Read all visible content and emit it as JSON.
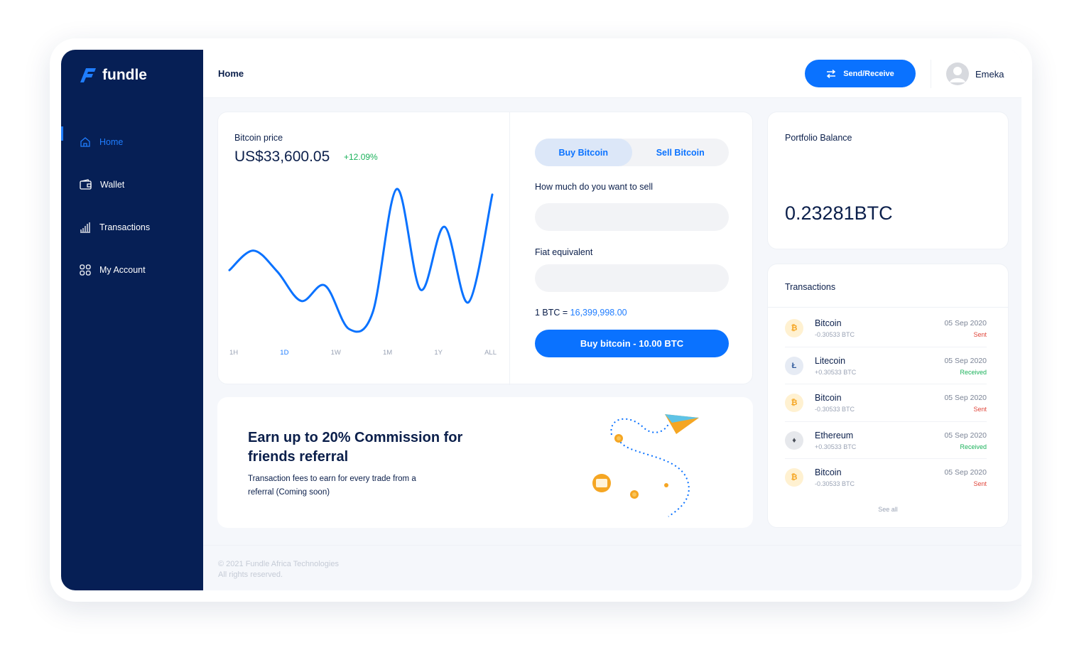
{
  "brand": {
    "name": "fundle",
    "accent": "#0a72ff",
    "sidebar_bg": "#061f55"
  },
  "sidebar": {
    "items": [
      {
        "label": "Home",
        "icon": "home-icon",
        "active": true
      },
      {
        "label": "Wallet",
        "icon": "wallet-icon",
        "active": false
      },
      {
        "label": "Transactions",
        "icon": "bar-chart-icon",
        "active": false
      },
      {
        "label": "My Account",
        "icon": "grid-icon",
        "active": false
      }
    ]
  },
  "header": {
    "title": "Home",
    "send_receive_label": "Send/Receive",
    "user_name": "Emeka"
  },
  "price_panel": {
    "label": "Bitcoin price",
    "value": "US$33,600.05",
    "change": "+12.09%",
    "change_color": "#1bb25b",
    "ranges": [
      "1H",
      "1D",
      "1W",
      "1M",
      "1Y",
      "ALL"
    ],
    "active_range": "1D"
  },
  "chart_data": {
    "type": "line",
    "title": "",
    "xlabel": "",
    "ylabel": "",
    "grid": false,
    "legend": "none",
    "series": [
      {
        "values": [
          0.42,
          0.56,
          0.41,
          0.2,
          0.31,
          0.0,
          0.12,
          1.0,
          0.28,
          0.73,
          0.19,
          0.96
        ]
      }
    ]
  },
  "trade_panel": {
    "tabs": [
      {
        "label": "Buy Bitcoin",
        "active": true
      },
      {
        "label": "Sell Bitcoin",
        "active": false
      }
    ],
    "amount_label": "How much do you want to sell",
    "amount_value": "",
    "fiat_label": "Fiat equivalent",
    "fiat_value": "",
    "rate_prefix": "1 BTC = ",
    "rate_value": "16,399,998.00",
    "buy_button_label": "Buy bitcoin - 10.00 BTC"
  },
  "promo": {
    "title": "Earn up to 20% Commission for friends referral",
    "subtitle": "Transaction fees to earn for every trade from a referral (Coming soon)"
  },
  "portfolio": {
    "label": "Portfolio Balance",
    "value": "0.23281BTC"
  },
  "transactions": {
    "title": "Transactions",
    "items": [
      {
        "coin": "Bitcoin",
        "symbol": "btc",
        "glyph": "₿",
        "amount": "-0.30533 BTC",
        "date": "05 Sep 2020",
        "status": "Sent"
      },
      {
        "coin": "Litecoin",
        "symbol": "ltc",
        "glyph": "Ł",
        "amount": "+0.30533 BTC",
        "date": "05 Sep 2020",
        "status": "Received"
      },
      {
        "coin": "Bitcoin",
        "symbol": "btc",
        "glyph": "₿",
        "amount": "-0.30533 BTC",
        "date": "05 Sep 2020",
        "status": "Sent"
      },
      {
        "coin": "Ethereum",
        "symbol": "eth",
        "glyph": "♦",
        "amount": "+0.30533 BTC",
        "date": "05 Sep 2020",
        "status": "Received"
      },
      {
        "coin": "Bitcoin",
        "symbol": "btc",
        "glyph": "₿",
        "amount": "-0.30533 BTC",
        "date": "05 Sep 2020",
        "status": "Sent"
      }
    ],
    "see_all_label": "See all"
  },
  "footer": {
    "line1": "© 2021 Fundle Africa Technologies",
    "line2": "All rights reserved."
  }
}
